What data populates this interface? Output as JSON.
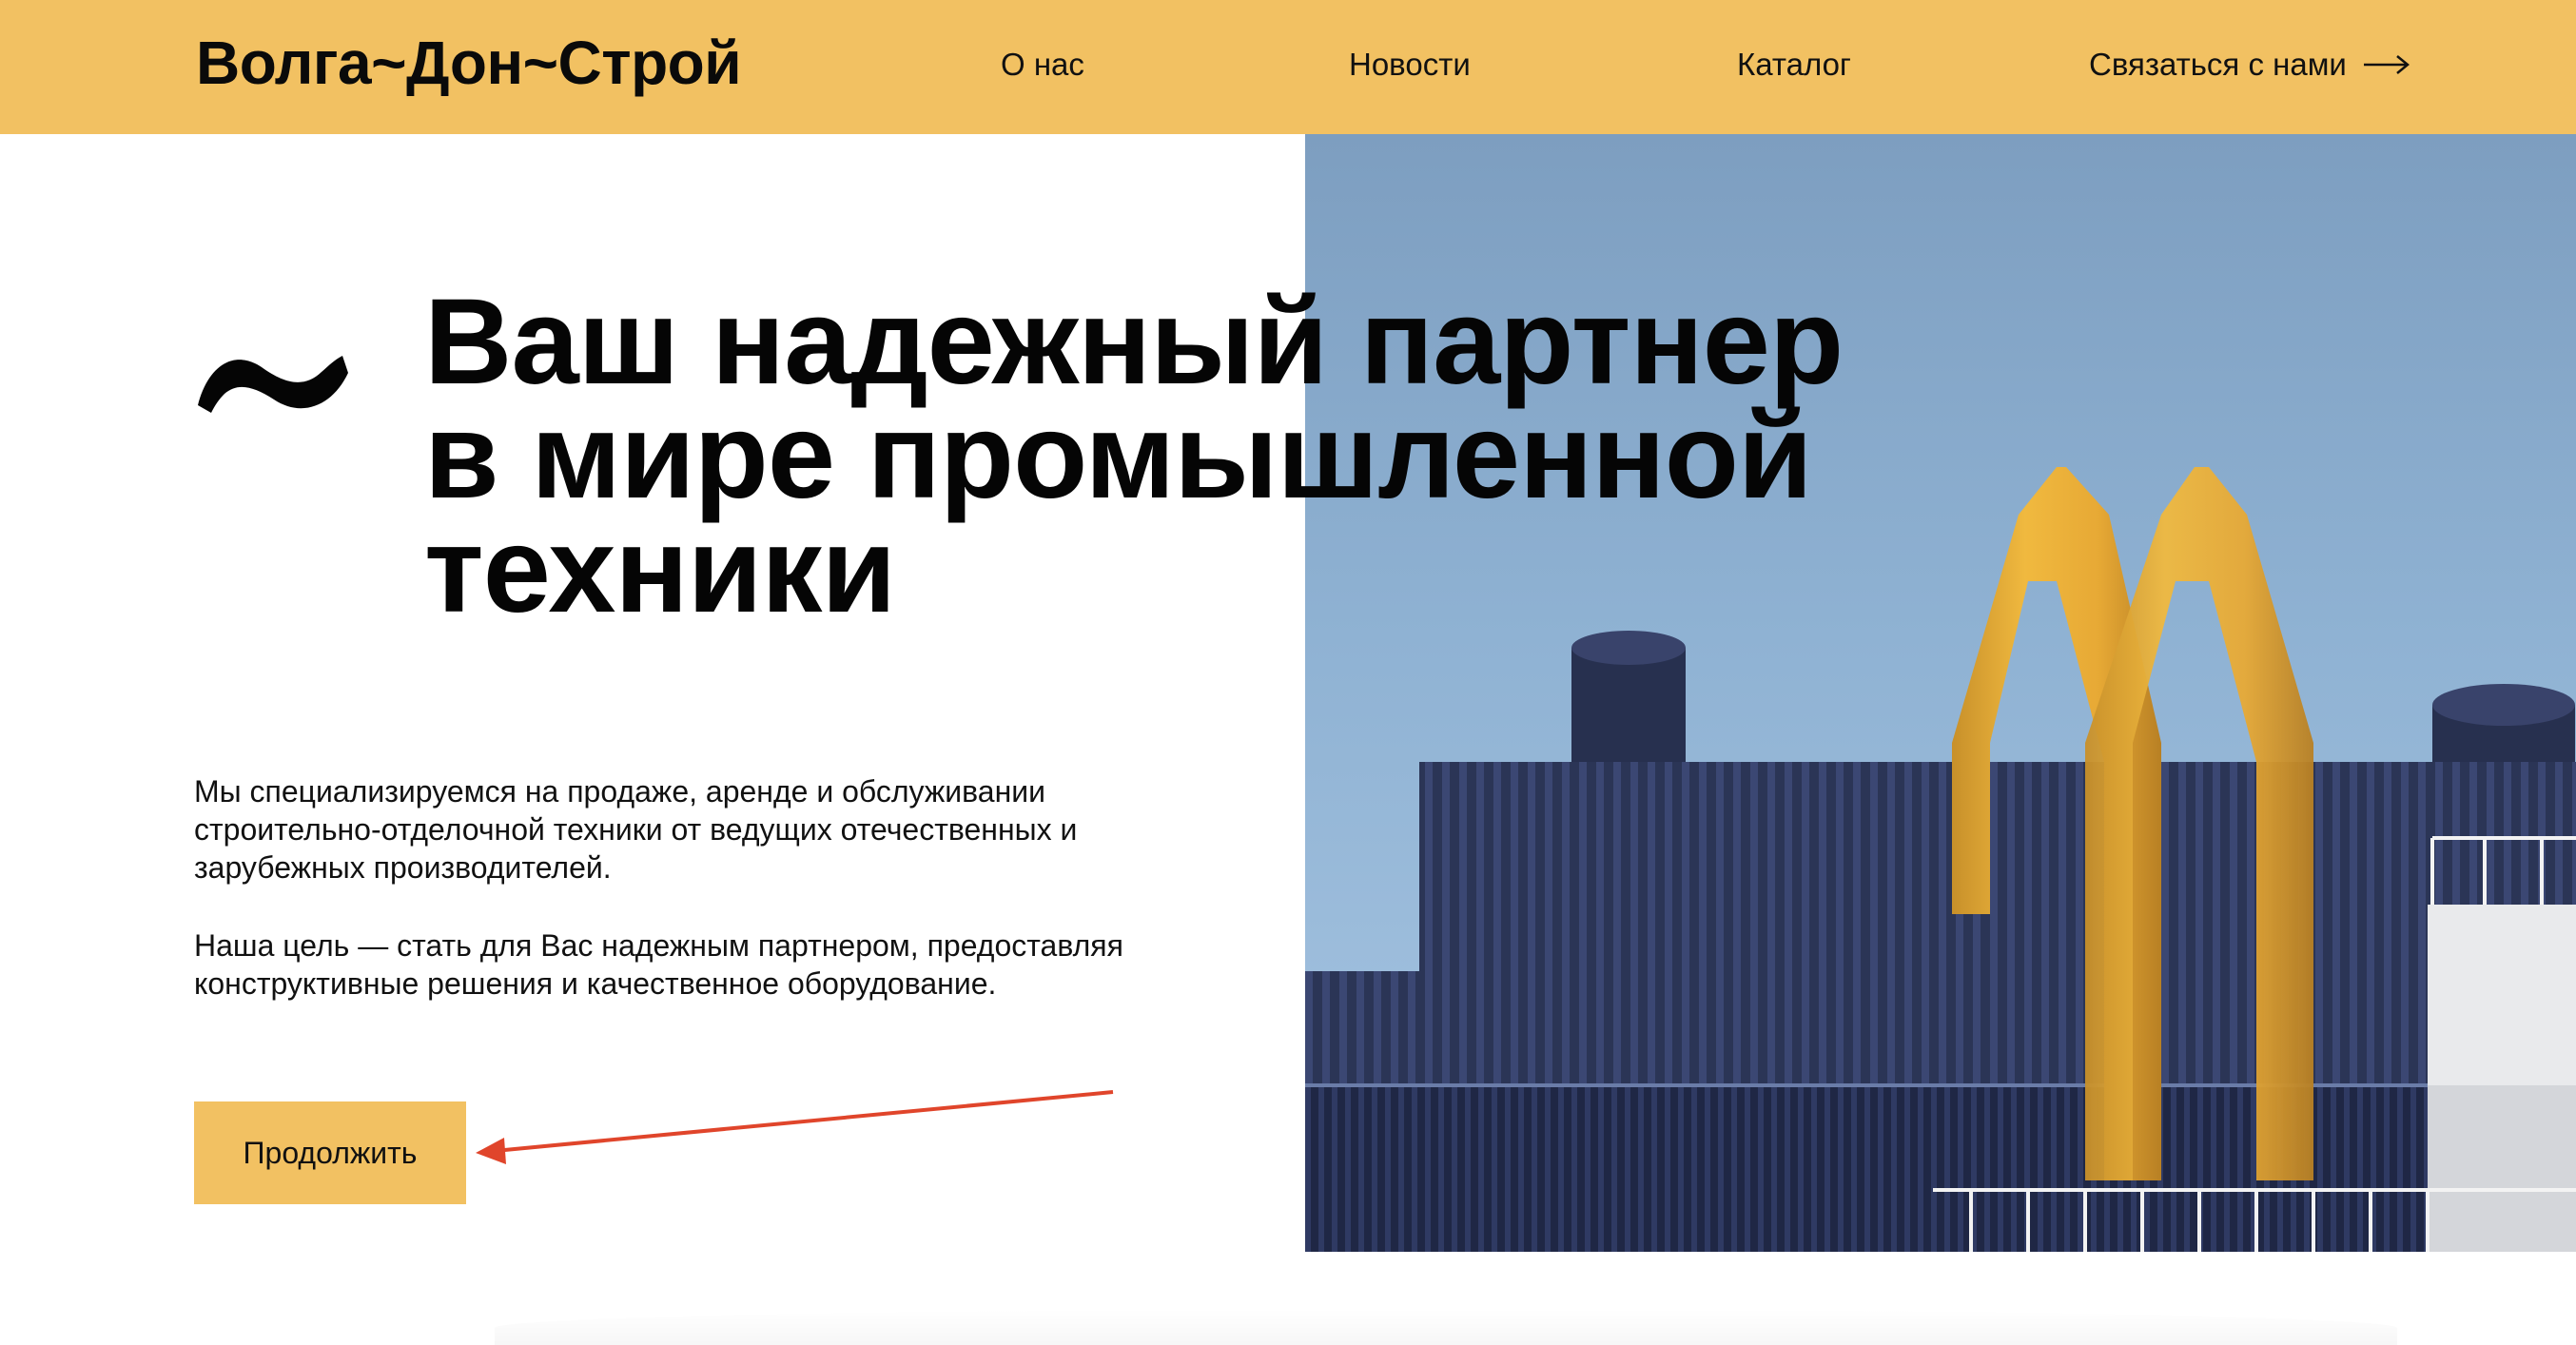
{
  "header": {
    "logo": "Волга~Дон~Строй",
    "nav": {
      "about": "О нас",
      "news": "Новости",
      "catalog": "Каталог",
      "contact": "Связаться с нами"
    },
    "background": "#f2c162"
  },
  "hero": {
    "headline": [
      "Ваш надежный партнер",
      "в мире промышленной",
      "техники"
    ],
    "paragraph_1": "Мы специализируемся на продаже, аренде и обслуживании строительно-отделочной техники от ведущих отечественных и зарубежных производителей.",
    "paragraph_2": "Наша цель — стать для Вас надежным партнером, предоставляя конструктивные решения и качественное оборудование.",
    "cta_label": "Продолжить",
    "accent_color": "#f2c162",
    "annotation_color": "#e0452b"
  }
}
